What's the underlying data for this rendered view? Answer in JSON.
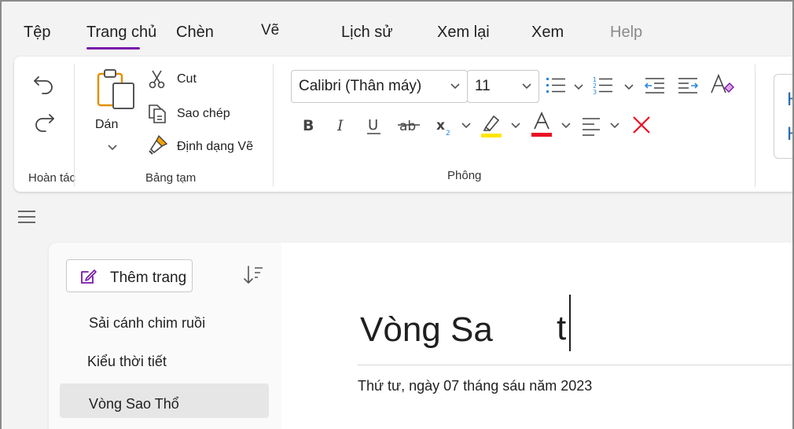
{
  "menu": {
    "tabs": [
      {
        "label": "Tệp"
      },
      {
        "label": "Trang chủ"
      },
      {
        "label": "Chèn"
      },
      {
        "label": "Vẽ"
      },
      {
        "label": "Lịch sử"
      },
      {
        "label": "Xem lại"
      },
      {
        "label": "Xem"
      },
      {
        "label": "Help"
      }
    ],
    "active_tab": "Trang chủ",
    "accent_color": "#7719aa"
  },
  "ribbon": {
    "undo_group": {
      "label": "Hoàn tác"
    },
    "clipboard": {
      "label": "Bảng tạm",
      "paste": "Dán",
      "cut": "Cut",
      "copy": "Sao chép",
      "format_painter": "Định dạng Vẽ"
    },
    "font": {
      "label": "Phông",
      "font_name": "Calibri (Thân máy)",
      "font_size": "11",
      "highlight_color": "#ffe600",
      "font_color": "#e81123",
      "clear_color": "#e81123"
    },
    "styles_preview": {
      "line1": "H",
      "line2": "H",
      "color": "#2b6cb0"
    }
  },
  "pages": {
    "add_page": "Thêm trang",
    "items": [
      {
        "title": "Sải cánh chim ruồi"
      },
      {
        "title": "Kiểu thời tiết"
      },
      {
        "title": "Vòng Sao Thổ"
      }
    ]
  },
  "editor": {
    "title": "Vòng Sa",
    "title_tail": "t",
    "date": "Thứ tư, ngày 07 tháng sáu năm 2023"
  }
}
